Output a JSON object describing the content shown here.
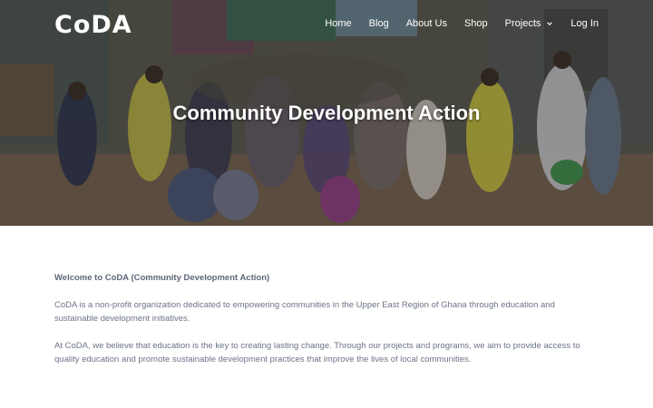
{
  "brand": {
    "logo_text": "CoDA"
  },
  "nav": {
    "items": [
      {
        "label": "Home"
      },
      {
        "label": "Blog"
      },
      {
        "label": "About Us"
      },
      {
        "label": "Shop"
      },
      {
        "label": "Projects",
        "icon": "chevron-down-icon"
      },
      {
        "label": "Log In"
      }
    ]
  },
  "hero": {
    "title": "Community Development Action",
    "image": "group-photo-of-community-members"
  },
  "content": {
    "intro": "Welcome to CoDA (Community Development Action)",
    "paragraph1": "CoDA is a non-profit organization dedicated to empowering communities in the Upper East Region of Ghana through education and sustainable development initiatives.",
    "paragraph2": "At CoDA, we believe that education is the key to creating lasting change. Through our projects and programs, we aim to provide access to quality education and promote sustainable development practices that improve the lives of local communities."
  },
  "colors": {
    "body_text": "#6b7486",
    "hero_text": "#ffffff"
  }
}
